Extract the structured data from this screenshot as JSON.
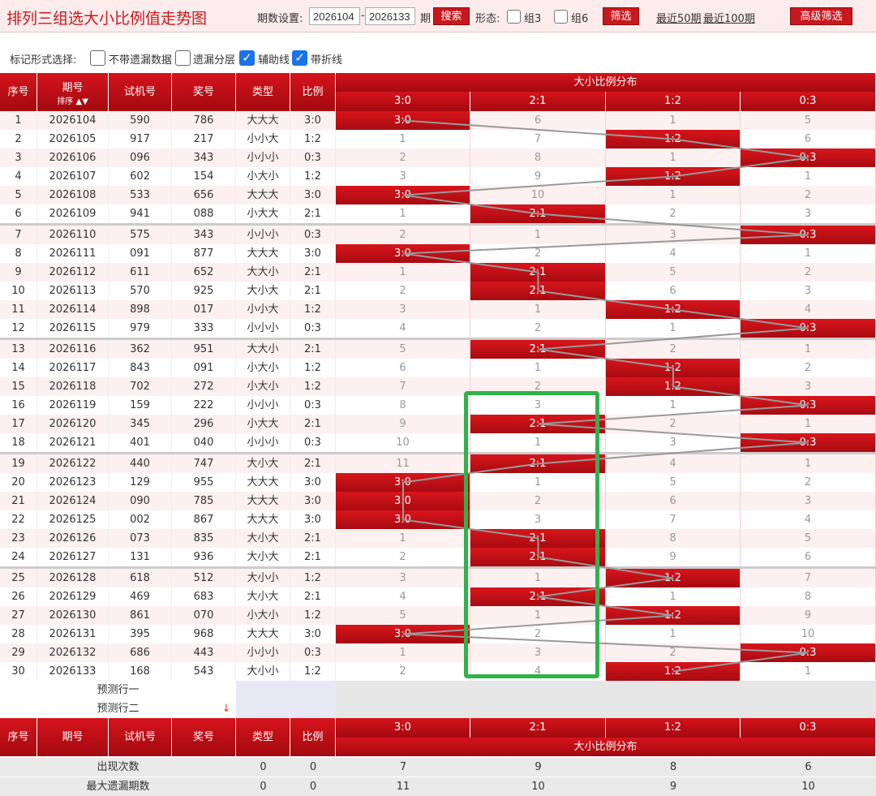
{
  "header": {
    "title": "排列三组选大小比例值走势图",
    "period_label": "期数设置:",
    "from": "2026104",
    "dash": "-",
    "to": "2026133",
    "period_suffix": "期",
    "search_label": "搜索",
    "form_label": "形态:",
    "group3_label": "组3",
    "group6_label": "组6",
    "filter_label": "筛选",
    "recent50": "最近50期",
    "recent100": "最近100期",
    "advanced_label": "高级筛选"
  },
  "options": {
    "label": "标记形式选择:",
    "items": [
      {
        "label": "不带遗漏数据",
        "checked": false
      },
      {
        "label": "遗漏分层",
        "checked": false
      },
      {
        "label": "辅助线",
        "checked": true
      },
      {
        "label": "带折线",
        "checked": true
      }
    ]
  },
  "table": {
    "head": {
      "seq": "序号",
      "period": "期号",
      "sort": "排序",
      "trial": "试机号",
      "prize": "奖号",
      "type": "类型",
      "ratio": "比例",
      "dist": "大小比例分布",
      "cols": [
        "3:0",
        "2:1",
        "1:2",
        "0:3"
      ]
    },
    "rows": [
      {
        "seq": "1",
        "period": "2026104",
        "trial": "590",
        "prize": "786",
        "type": "大大大",
        "ratio": "3:0",
        "dist": [
          "3:0",
          "6",
          "1",
          "5"
        ],
        "hit": 0
      },
      {
        "seq": "2",
        "period": "2026105",
        "trial": "917",
        "prize": "217",
        "type": "小小大",
        "ratio": "1:2",
        "dist": [
          "1",
          "7",
          "1:2",
          "6"
        ],
        "hit": 2
      },
      {
        "seq": "3",
        "period": "2026106",
        "trial": "096",
        "prize": "343",
        "type": "小小小",
        "ratio": "0:3",
        "dist": [
          "2",
          "8",
          "1",
          "0:3"
        ],
        "hit": 3
      },
      {
        "seq": "4",
        "period": "2026107",
        "trial": "602",
        "prize": "154",
        "type": "小大小",
        "ratio": "1:2",
        "dist": [
          "3",
          "9",
          "1:2",
          "1"
        ],
        "hit": 2
      },
      {
        "seq": "5",
        "period": "2026108",
        "trial": "533",
        "prize": "656",
        "type": "大大大",
        "ratio": "3:0",
        "dist": [
          "3:0",
          "10",
          "1",
          "2"
        ],
        "hit": 0
      },
      {
        "seq": "6",
        "period": "2026109",
        "trial": "941",
        "prize": "088",
        "type": "小大大",
        "ratio": "2:1",
        "dist": [
          "1",
          "2:1",
          "2",
          "3"
        ],
        "hit": 1
      },
      {
        "seq": "7",
        "period": "2026110",
        "trial": "575",
        "prize": "343",
        "type": "小小小",
        "ratio": "0:3",
        "dist": [
          "2",
          "1",
          "3",
          "0:3"
        ],
        "hit": 3
      },
      {
        "seq": "8",
        "period": "2026111",
        "trial": "091",
        "prize": "877",
        "type": "大大大",
        "ratio": "3:0",
        "dist": [
          "3:0",
          "2",
          "4",
          "1"
        ],
        "hit": 0
      },
      {
        "seq": "9",
        "period": "2026112",
        "trial": "611",
        "prize": "652",
        "type": "大大小",
        "ratio": "2:1",
        "dist": [
          "1",
          "2:1",
          "5",
          "2"
        ],
        "hit": 1
      },
      {
        "seq": "10",
        "period": "2026113",
        "trial": "570",
        "prize": "925",
        "type": "大小大",
        "ratio": "2:1",
        "dist": [
          "2",
          "2:1",
          "6",
          "3"
        ],
        "hit": 1
      },
      {
        "seq": "11",
        "period": "2026114",
        "trial": "898",
        "prize": "017",
        "type": "小小大",
        "ratio": "1:2",
        "dist": [
          "3",
          "1",
          "1:2",
          "4"
        ],
        "hit": 2
      },
      {
        "seq": "12",
        "period": "2026115",
        "trial": "979",
        "prize": "333",
        "type": "小小小",
        "ratio": "0:3",
        "dist": [
          "4",
          "2",
          "1",
          "0:3"
        ],
        "hit": 3
      },
      {
        "seq": "13",
        "period": "2026116",
        "trial": "362",
        "prize": "951",
        "type": "大大小",
        "ratio": "2:1",
        "dist": [
          "5",
          "2:1",
          "2",
          "1"
        ],
        "hit": 1
      },
      {
        "seq": "14",
        "period": "2026117",
        "trial": "843",
        "prize": "091",
        "type": "小大小",
        "ratio": "1:2",
        "dist": [
          "6",
          "1",
          "1:2",
          "2"
        ],
        "hit": 2
      },
      {
        "seq": "15",
        "period": "2026118",
        "trial": "702",
        "prize": "272",
        "type": "小大小",
        "ratio": "1:2",
        "dist": [
          "7",
          "2",
          "1:2",
          "3"
        ],
        "hit": 2
      },
      {
        "seq": "16",
        "period": "2026119",
        "trial": "159",
        "prize": "222",
        "type": "小小小",
        "ratio": "0:3",
        "dist": [
          "8",
          "3",
          "1",
          "0:3"
        ],
        "hit": 3
      },
      {
        "seq": "17",
        "period": "2026120",
        "trial": "345",
        "prize": "296",
        "type": "小大大",
        "ratio": "2:1",
        "dist": [
          "9",
          "2:1",
          "2",
          "1"
        ],
        "hit": 1
      },
      {
        "seq": "18",
        "period": "2026121",
        "trial": "401",
        "prize": "040",
        "type": "小小小",
        "ratio": "0:3",
        "dist": [
          "10",
          "1",
          "3",
          "0:3"
        ],
        "hit": 3
      },
      {
        "seq": "19",
        "period": "2026122",
        "trial": "440",
        "prize": "747",
        "type": "大小大",
        "ratio": "2:1",
        "dist": [
          "11",
          "2:1",
          "4",
          "1"
        ],
        "hit": 1
      },
      {
        "seq": "20",
        "period": "2026123",
        "trial": "129",
        "prize": "955",
        "type": "大大大",
        "ratio": "3:0",
        "dist": [
          "3:0",
          "1",
          "5",
          "2"
        ],
        "hit": 0
      },
      {
        "seq": "21",
        "period": "2026124",
        "trial": "090",
        "prize": "785",
        "type": "大大大",
        "ratio": "3:0",
        "dist": [
          "3:0",
          "2",
          "6",
          "3"
        ],
        "hit": 0
      },
      {
        "seq": "22",
        "period": "2026125",
        "trial": "002",
        "prize": "867",
        "type": "大大大",
        "ratio": "3:0",
        "dist": [
          "3:0",
          "3",
          "7",
          "4"
        ],
        "hit": 0
      },
      {
        "seq": "23",
        "period": "2026126",
        "trial": "073",
        "prize": "835",
        "type": "大小大",
        "ratio": "2:1",
        "dist": [
          "1",
          "2:1",
          "8",
          "5"
        ],
        "hit": 1
      },
      {
        "seq": "24",
        "period": "2026127",
        "trial": "131",
        "prize": "936",
        "type": "大小大",
        "ratio": "2:1",
        "dist": [
          "2",
          "2:1",
          "9",
          "6"
        ],
        "hit": 1
      },
      {
        "seq": "25",
        "period": "2026128",
        "trial": "618",
        "prize": "512",
        "type": "大小小",
        "ratio": "1:2",
        "dist": [
          "3",
          "1",
          "1:2",
          "7"
        ],
        "hit": 2
      },
      {
        "seq": "26",
        "period": "2026129",
        "trial": "469",
        "prize": "683",
        "type": "大小大",
        "ratio": "2:1",
        "dist": [
          "4",
          "2:1",
          "1",
          "8"
        ],
        "hit": 1
      },
      {
        "seq": "27",
        "period": "2026130",
        "trial": "861",
        "prize": "070",
        "type": "小大小",
        "ratio": "1:2",
        "dist": [
          "5",
          "1",
          "1:2",
          "9"
        ],
        "hit": 2
      },
      {
        "seq": "28",
        "period": "2026131",
        "trial": "395",
        "prize": "968",
        "type": "大大大",
        "ratio": "3:0",
        "dist": [
          "3:0",
          "2",
          "1",
          "10"
        ],
        "hit": 0
      },
      {
        "seq": "29",
        "period": "2026132",
        "trial": "686",
        "prize": "443",
        "type": "小小小",
        "ratio": "0:3",
        "dist": [
          "1",
          "3",
          "2",
          "0:3"
        ],
        "hit": 3
      },
      {
        "seq": "30",
        "period": "2026133",
        "trial": "168",
        "prize": "543",
        "type": "大小小",
        "ratio": "1:2",
        "dist": [
          "2",
          "4",
          "1:2",
          "1"
        ],
        "hit": 2
      }
    ],
    "predict1": "预测行一",
    "predict2": "预测行二",
    "summary": [
      {
        "label": "出现次数",
        "type": "0",
        "ratio": "0",
        "values": [
          "7",
          "9",
          "8",
          "6"
        ]
      },
      {
        "label": "最大遗漏期数",
        "type": "0",
        "ratio": "0",
        "values": [
          "11",
          "10",
          "9",
          "10"
        ]
      }
    ]
  },
  "colors": {
    "accent": "#c8181e",
    "highlight_box": "#2fb24a"
  }
}
